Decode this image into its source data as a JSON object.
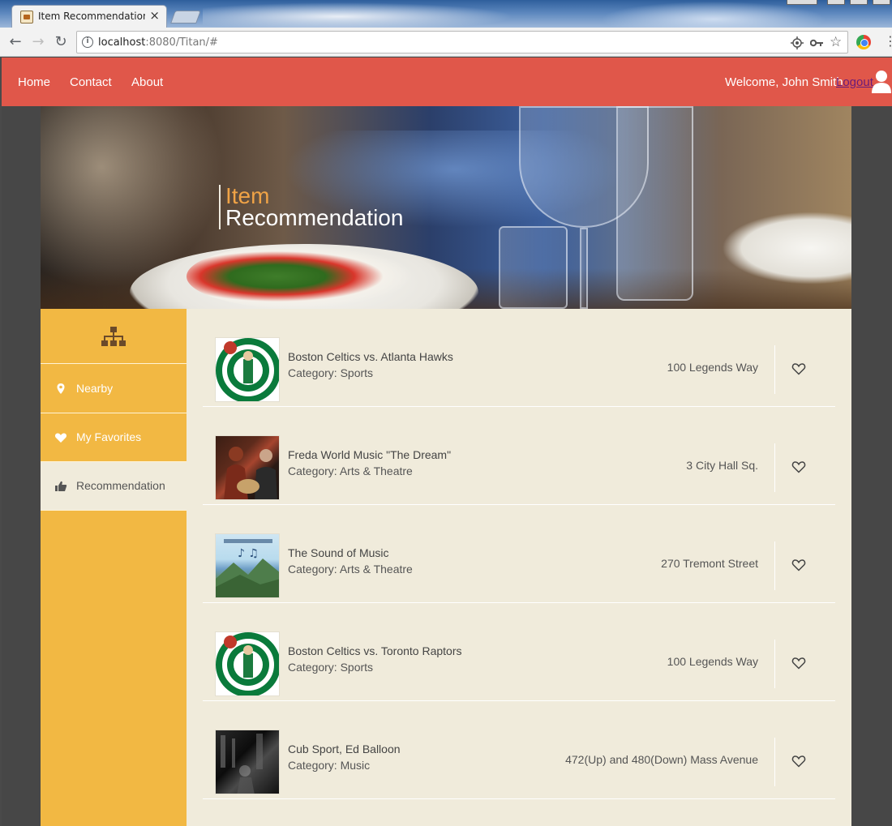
{
  "browser": {
    "tab_title": "Item Recommendation F",
    "tab_close": "×",
    "url_host": "localhost",
    "url_path": ":8080/Titan/#",
    "back": "←",
    "forward": "→",
    "reload": "↻",
    "bookmark": "☆",
    "menu": "⋮",
    "info": "i"
  },
  "nav": {
    "links": [
      "Home",
      "Contact",
      "About"
    ],
    "welcome": "Welcome, John Smith",
    "logout": "Logout"
  },
  "hero": {
    "line1": "Item",
    "line2": "Recommendation"
  },
  "sidebar": {
    "items": [
      {
        "label": "Nearby",
        "icon": "map-pin-icon"
      },
      {
        "label": "My Favorites",
        "icon": "heart-icon"
      },
      {
        "label": "Recommendation",
        "icon": "thumbs-up-icon",
        "active": true
      }
    ]
  },
  "items": [
    {
      "name": "Boston Celtics vs. Atlanta Hawks",
      "category": "Category: Sports",
      "address": "100 Legends Way",
      "image": "celtics-logo"
    },
    {
      "name": "Freda World Music \"The Dream\"",
      "category": "Category: Arts & Theatre",
      "address": "3 City Hall Sq.",
      "image": "concert-photo"
    },
    {
      "name": "The Sound of Music",
      "category": "Category: Arts & Theatre",
      "address": "270 Tremont Street",
      "image": "sound-of-music-poster"
    },
    {
      "name": "Boston Celtics vs. Toronto Raptors",
      "category": "Category: Sports",
      "address": "100 Legends Way",
      "image": "celtics-logo"
    },
    {
      "name": "Cub Sport, Ed Balloon",
      "category": "Category: Music",
      "address": "472(Up) and 480(Down) Mass Avenue",
      "image": "band-photo"
    }
  ],
  "colors": {
    "nav_bg": "#e0574a",
    "sidebar_bg": "#f2b843",
    "content_bg": "#f0ebdb",
    "hero_accent": "#f0a346"
  }
}
